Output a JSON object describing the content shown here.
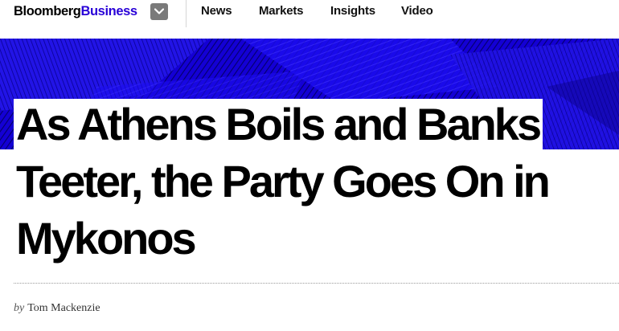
{
  "header": {
    "logo_main": "Bloomberg",
    "logo_sub": "Business",
    "menu_icon": "chevron-down-icon",
    "nav": [
      {
        "label": "News"
      },
      {
        "label": "Markets"
      },
      {
        "label": "Insights"
      },
      {
        "label": "Video"
      }
    ]
  },
  "hero": {
    "background_color": "#1400d4",
    "pattern": "halftone-stripes"
  },
  "article": {
    "headline": "As Athens Boils and Banks Teeter, the Party Goes On in Mykonos",
    "byline_prefix": "by",
    "author": "Tom Mackenzie"
  },
  "colors": {
    "brand_blue": "#2800d7",
    "text": "#000000"
  }
}
